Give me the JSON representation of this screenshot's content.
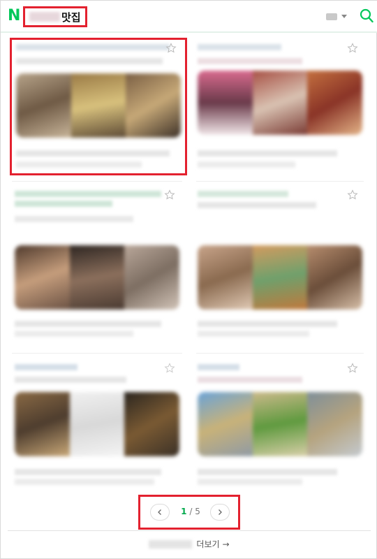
{
  "header": {
    "logo_letter": "N",
    "title_suffix": "맛집",
    "accent": "#03c75a"
  },
  "pagination": {
    "current": "1",
    "separator": " / ",
    "total": "5"
  },
  "more": {
    "label": "더보기",
    "arrow": "→"
  },
  "icons": {
    "search": "search-icon",
    "star": "star-icon",
    "keyboard": "keyboard-icon",
    "prev": "chevron-left-icon",
    "next": "chevron-right-icon"
  },
  "colors": {
    "brand": "#03c75a",
    "highlight": "#e3212f"
  }
}
